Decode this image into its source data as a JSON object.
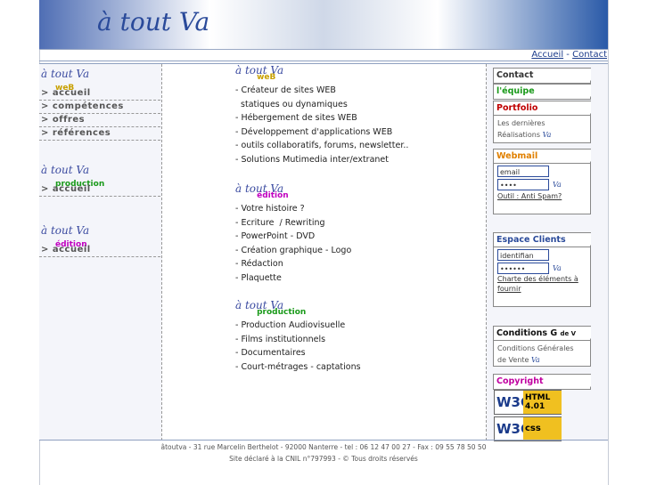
{
  "logo": "à tout Va",
  "toplinks": {
    "home": "Accueil",
    "sep": "-",
    "contact": "Contact"
  },
  "left": {
    "web": {
      "logo": "à tout Va",
      "sub": "weB",
      "items": [
        "> accueil",
        "> compétences",
        "> offres",
        "> références"
      ]
    },
    "production": {
      "logo": "à tout Va",
      "sub": "production",
      "items": [
        "> accueil"
      ]
    },
    "edition": {
      "logo": "à tout Va",
      "sub": "édition",
      "items": [
        "> accueil"
      ]
    }
  },
  "center": {
    "web": {
      "logo": "à tout Va",
      "sub": "weB",
      "items": [
        "- Créateur de sites WEB",
        "  statiques ou dynamiques",
        "- Hébergement de sites WEB",
        "- Développement d'applications WEB",
        "- outils collaboratifs, forums, newsletter..",
        "- Solutions Mutimedia inter/extranet"
      ]
    },
    "edition": {
      "logo": "à tout Va",
      "sub": "édition",
      "items": [
        "- Votre histoire ?",
        "- Ecriture  / Rewriting",
        "- PowerPoint - DVD",
        "- Création graphique - Logo",
        "- Rédaction",
        "- Plaquette"
      ]
    },
    "production": {
      "logo": "à tout Va",
      "sub": "production",
      "items": [
        "- Production Audiovisuelle",
        "- Films institutionnels",
        "- Documentaires",
        "- Court-métrages - captations"
      ]
    }
  },
  "right": {
    "contact": "Contact",
    "equipe": "l'équipe",
    "portfolio": {
      "title": "Portfolio",
      "line1": "Les dernières",
      "line2": "Réalisations"
    },
    "webmail": {
      "title": "Webmail",
      "email": "email",
      "pass": "••••",
      "link": "Outil : Anti Spam?"
    },
    "clients": {
      "title": "Espace Clients",
      "id": "identifian",
      "pass": "••••••",
      "link": "Charte des éléments à fournir"
    },
    "conditions": {
      "title": "Conditions G",
      "title_small": "de V",
      "line1": "Conditions Générales",
      "line2": "de Vente"
    },
    "copyright": "Copyright",
    "badges": {
      "html": "HTML 4.01",
      "css": "css",
      "w3c": "W3C"
    },
    "go": "Va"
  },
  "footer": {
    "line1": "âtoutva - 31 rue Marcelin Berthelot - 92000 Nanterre - tel : 06 12 47 00 27 - Fax : 09 55 78 50 50",
    "line2": "Site déclaré à la CNIL n°797993 - © Tous droits réservés"
  },
  "colors": {
    "accent": "#2a4a9a",
    "web": "#c8a000",
    "production": "#1a9a1a",
    "edition": "#c000c0",
    "webmail": "#e08000",
    "copyright": "#c000a0"
  }
}
